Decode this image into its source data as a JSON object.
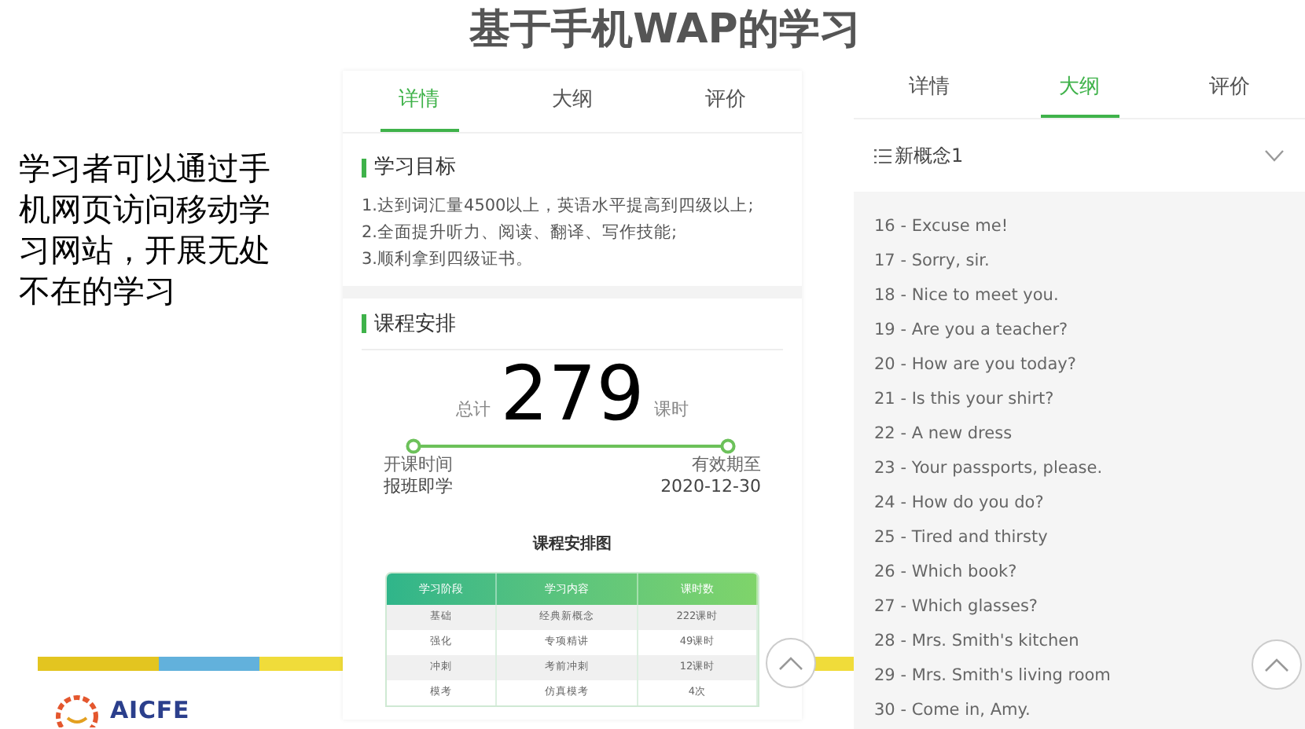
{
  "title": "基于手机WAP的学习",
  "description": "学习者可以通过手机网页访问移动学习网站，开展无处不在的学习",
  "logo": {
    "text": "AICFE"
  },
  "detail_screen": {
    "tabs": [
      {
        "label": "详情",
        "selected": true
      },
      {
        "label": "大纲",
        "selected": false
      },
      {
        "label": "评价",
        "selected": false
      }
    ],
    "goals": {
      "heading": "学习目标",
      "lines": [
        "1.达到词汇量4500以上，英语水平提高到四级以上;",
        "2.全面提升听力、阅读、翻译、写作技能;",
        "3.顺利拿到四级证书。"
      ]
    },
    "schedule": {
      "heading": "课程安排",
      "total_label": "总计",
      "total": "279",
      "unit": "课时",
      "start_label": "开课时间",
      "start_value": "报班即学",
      "end_label": "有效期至",
      "end_value": "2020-12-30",
      "chart_title": "课程安排图",
      "columns": [
        "学习阶段",
        "学习内容",
        "课时数"
      ],
      "rows": [
        [
          "基础",
          "经典新概念",
          "222课时"
        ],
        [
          "强化",
          "专项精讲",
          "49课时"
        ],
        [
          "冲刺",
          "考前冲刺",
          "12课时"
        ],
        [
          "模考",
          "仿真模考",
          "4次"
        ]
      ]
    }
  },
  "outline_screen": {
    "tabs": [
      {
        "label": "详情",
        "selected": false
      },
      {
        "label": "大纲",
        "selected": true
      },
      {
        "label": "评价",
        "selected": false
      }
    ],
    "dropdown": "新概念1",
    "lessons": [
      "16 - Excuse me!",
      "17 - Sorry, sir.",
      "18 - Nice to meet you.",
      "19 - Are you a teacher?",
      "20 - How are you today?",
      "21 - Is this your shirt?",
      "22 - A new dress",
      "23 - Your passports, please.",
      "24 - How do you do?",
      "25 - Tired and thirsty",
      "26 - Which book?",
      "27 - Which glasses?",
      "28 - Mrs. Smith's kitchen",
      "29 - Mrs. Smith's living room",
      "30 - Come in, Amy."
    ]
  }
}
